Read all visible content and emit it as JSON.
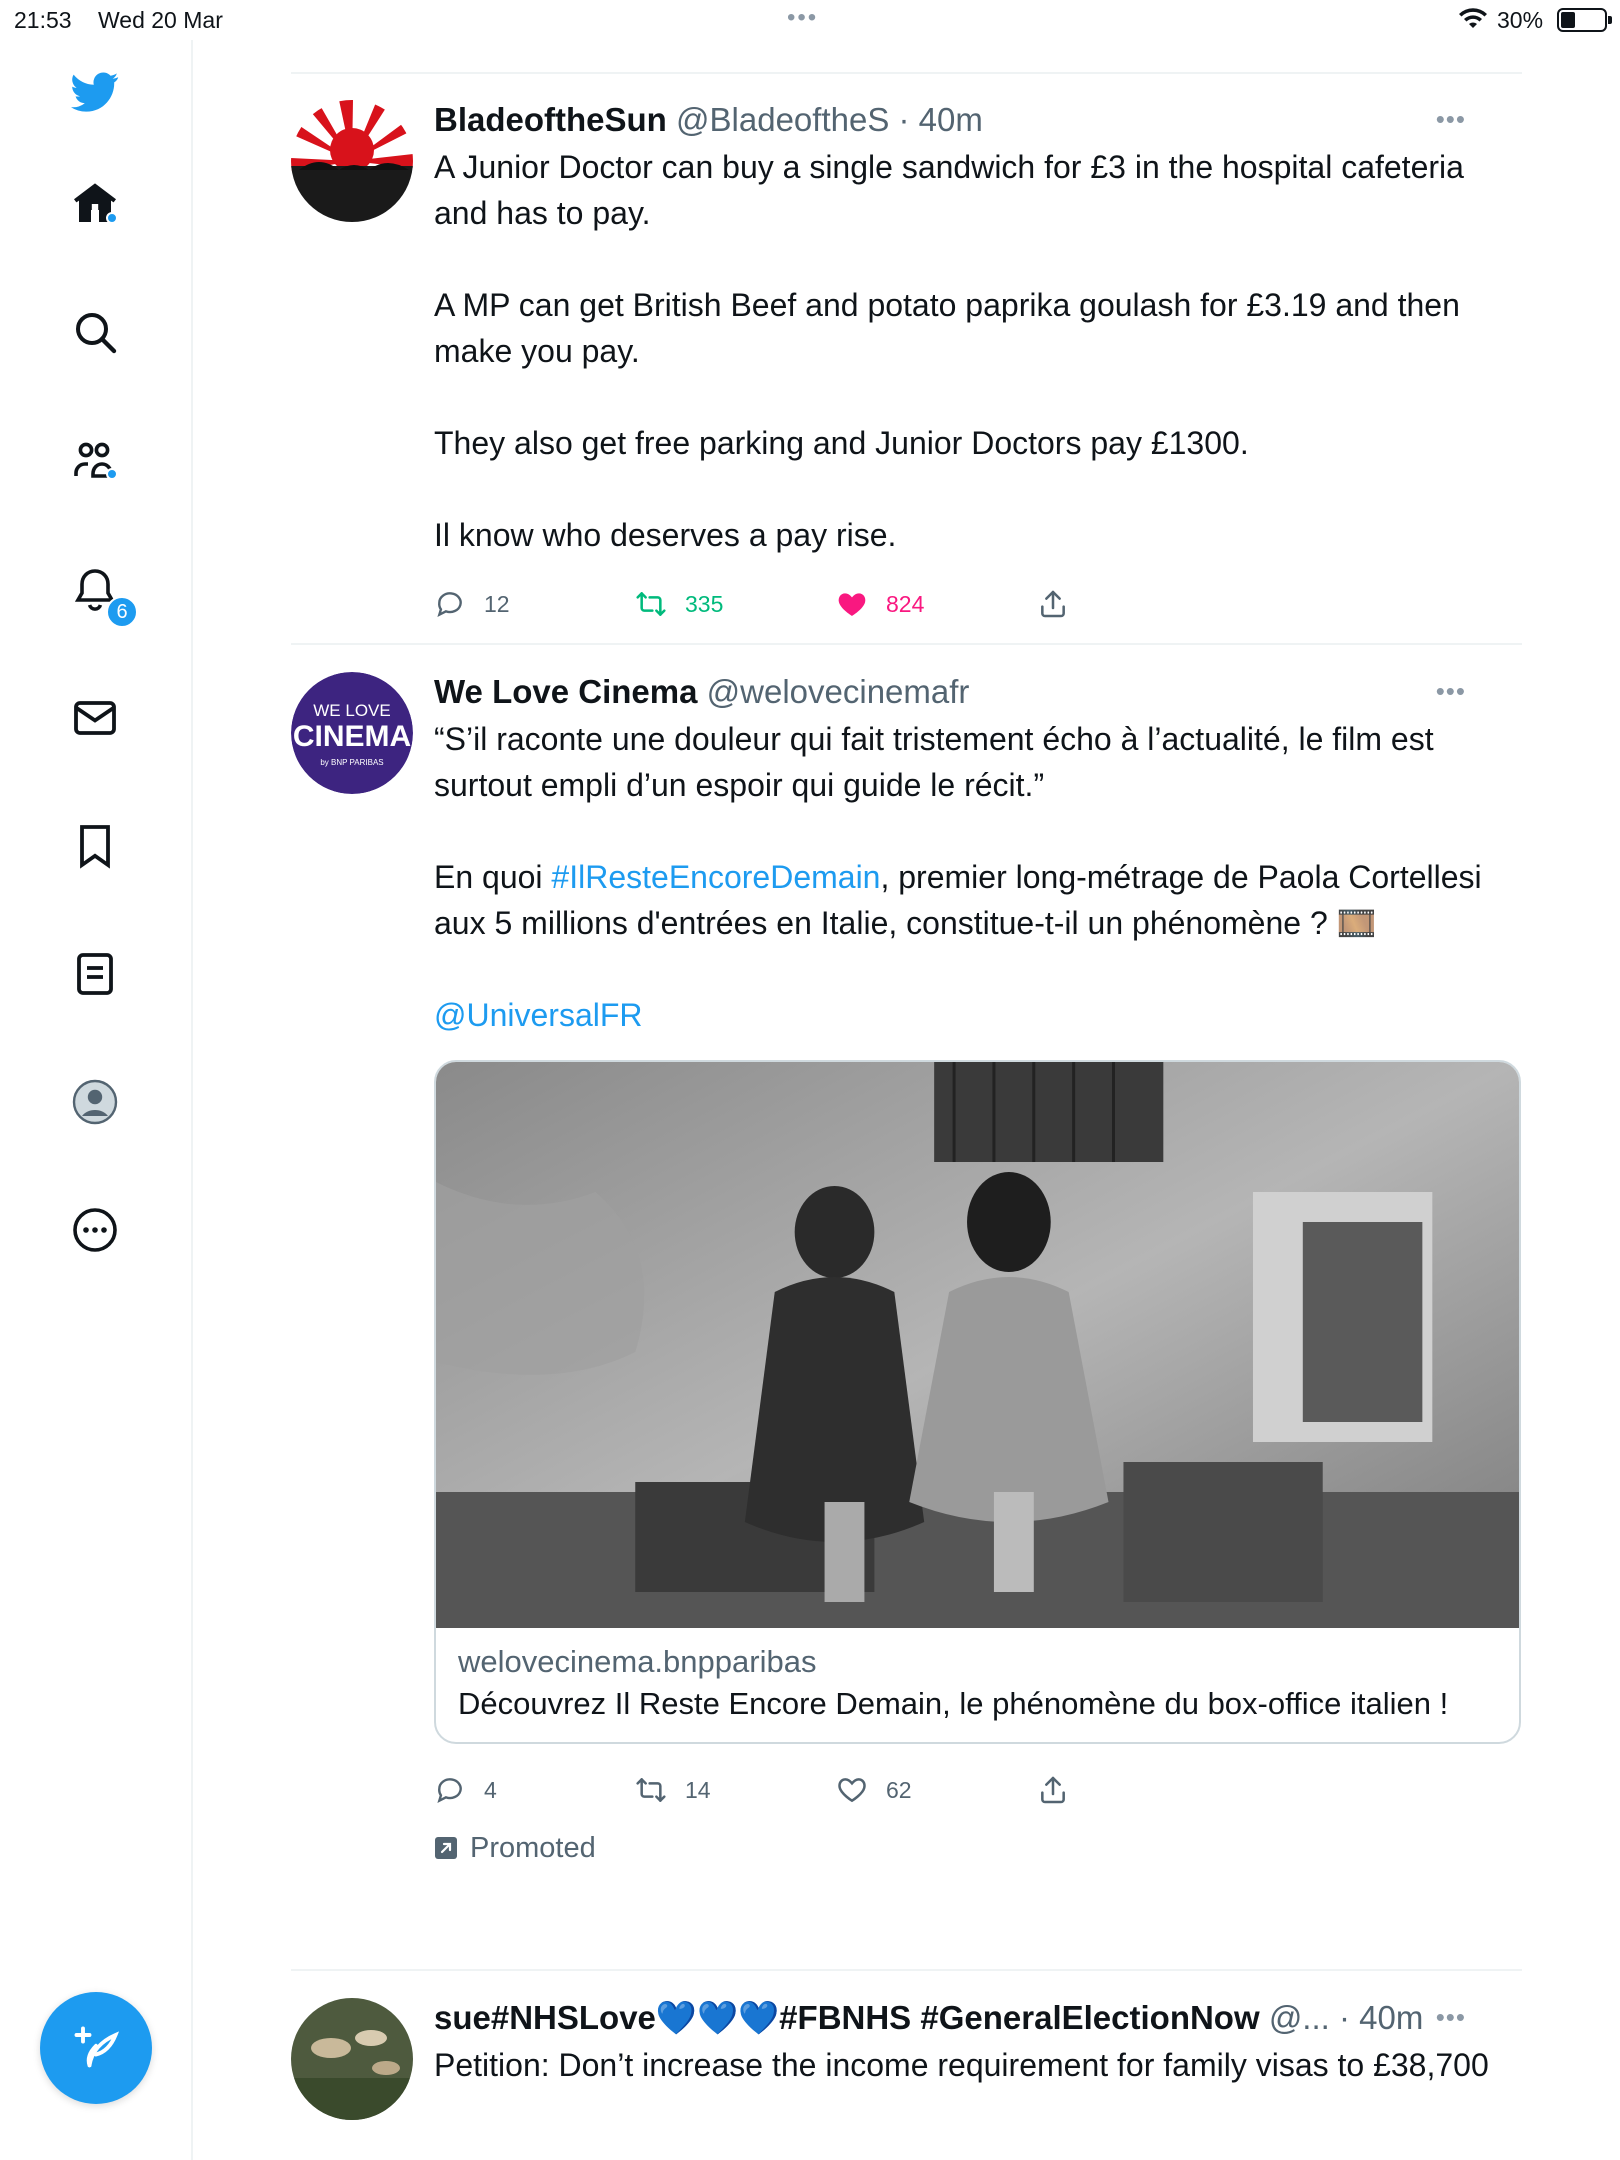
{
  "status_bar": {
    "time": "21:53",
    "date": "Wed 20 Mar",
    "battery": "30%"
  },
  "sidebar": {
    "items": [
      {
        "icon": "twitter-logo-icon"
      },
      {
        "icon": "home-icon"
      },
      {
        "icon": "search-icon"
      },
      {
        "icon": "communities-icon"
      },
      {
        "icon": "notifications-icon",
        "badge": "6"
      },
      {
        "icon": "messages-icon"
      },
      {
        "icon": "bookmarks-icon"
      },
      {
        "icon": "lists-icon"
      },
      {
        "icon": "profile-icon"
      },
      {
        "icon": "more-icon"
      }
    ],
    "compose_icon": "compose-tweet-icon"
  },
  "tweets": [
    {
      "name": "BladeoftheSun",
      "handle": "@BladeoftheS",
      "sep": "·",
      "time": "40m",
      "paragraphs": [
        "A Junior Doctor can buy a single sandwich for £3 in the hospital cafeteria and has to pay.",
        "A MP can get British Beef and potato paprika goulash for £3.19 and then make you pay.",
        "They also get free parking and Junior Doctors pay £1300.",
        "Il know who deserves a pay rise."
      ],
      "replies": "12",
      "retweets": "335",
      "likes": "824"
    },
    {
      "name": "We Love Cinema",
      "handle": "@welovecinemafr",
      "paragraphs": [
        "“S’il raconte une douleur qui fait tristement écho à l’actualité, le film est surtout empli d’un espoir qui guide le récit.”"
      ],
      "p2_before": "En quoi ",
      "hashtag": "#IlResteEncoreDemain",
      "p2_after": ", premier long-métrage de Paola Cortellesi aux 5 millions d'entrées en Italie, constitue-t-il un phénomène ? 🎞️",
      "mention": "@UniversalFR",
      "card": {
        "domain": "welovecinema.bnpparibas",
        "title": "Découvrez Il Reste Encore Demain, le phénomène du box-office italien !"
      },
      "replies": "4",
      "retweets": "14",
      "likes": "62",
      "promoted": "Promoted",
      "avatar_text": {
        "line1": "WE LOVE",
        "line2": "CINEMA",
        "line3": "by BNP PARIBAS"
      }
    },
    {
      "name": "sue#NHSLove💙💙💙#FBNHS #GeneralElectionNow",
      "handle": "@...",
      "sep": "·",
      "time": "40m",
      "paragraphs": [
        "Petition: Don’t increase the income requirement for family visas to £38,700"
      ]
    }
  ],
  "colors": {
    "accent": "#1d9bf0",
    "like_active": "#f91880",
    "retweet_active": "#00ba7c",
    "text_secondary": "#536471"
  }
}
